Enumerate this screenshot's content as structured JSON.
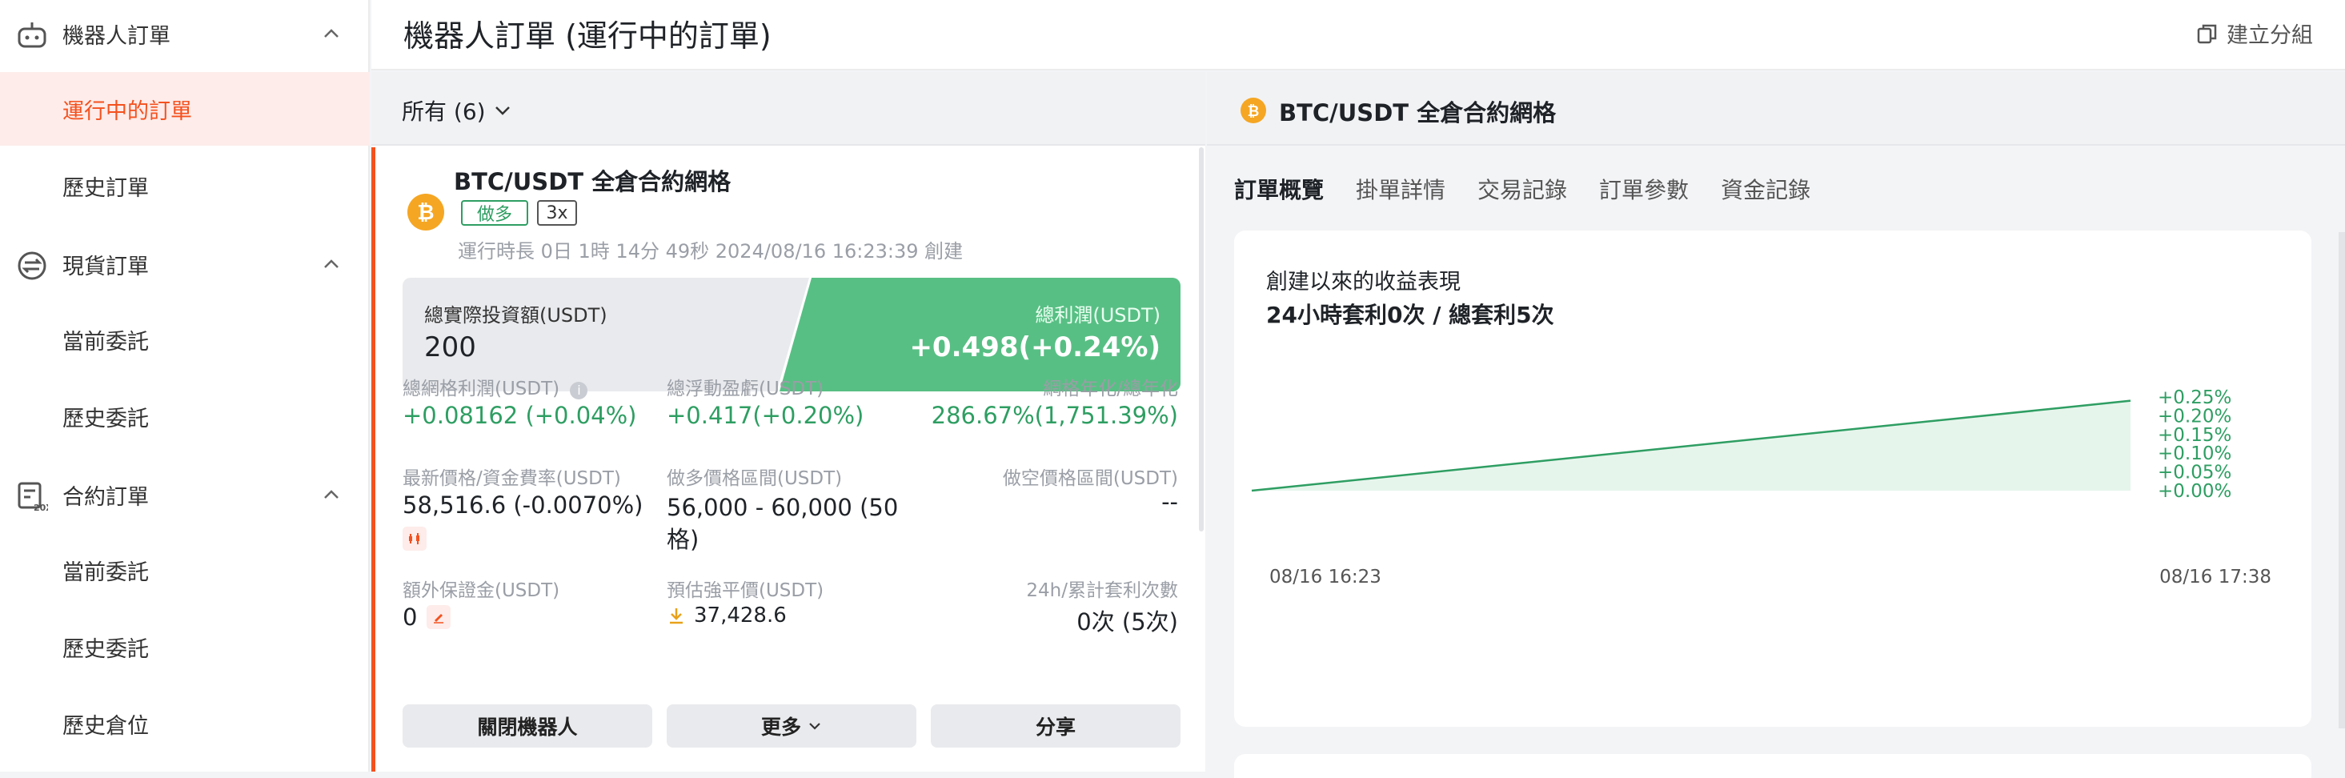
{
  "sidebar": {
    "groups": [
      {
        "label": "機器人訂單",
        "icon": "robot-icon",
        "items": [
          "運行中的訂單",
          "歷史訂單"
        ]
      },
      {
        "label": "現貨訂單",
        "icon": "exchange-icon",
        "items": [
          "當前委託",
          "歷史委託"
        ]
      },
      {
        "label": "合約訂單",
        "icon": "contract-icon",
        "items": [
          "當前委託",
          "歷史委託",
          "歷史倉位"
        ]
      }
    ]
  },
  "header": {
    "title": "機器人訂單 (運行中的訂單)",
    "create_group": "建立分組"
  },
  "filter": {
    "label": "所有 (6)"
  },
  "order": {
    "pair": "BTC/USDT 全倉合約網格",
    "direction": "做多",
    "leverage": "3x",
    "runtime": "運行時長 0日 1時 14分 49秒 2024/08/16 16:23:39 創建",
    "invest_label": "總實際投資額(USDT)",
    "invest_value": "200",
    "profit_label": "總利潤(USDT)",
    "profit_value": "+0.498(+0.24%)",
    "grid_profit_label": "總網格利潤(USDT)",
    "grid_profit_value": "+0.08162 (+0.04%)",
    "float_pnl_label": "總浮動盈虧(USDT)",
    "float_pnl_value": "+0.417(+0.20%)",
    "apr_label": "網格年化/總年化",
    "apr_value": "286.67%(1,751.39%)",
    "last_price_label": "最新價格/資金費率(USDT)",
    "last_price_value": "58,516.6 (-0.0070%)",
    "long_range_label": "做多價格區間(USDT)",
    "long_range_value": "56,000 - 60,000 (50格)",
    "short_range_label": "做空價格區間(USDT)",
    "short_range_value": "--",
    "extra_margin_label": "額外保證金(USDT)",
    "extra_margin_value": "0",
    "liq_label": "預估強平價(USDT)",
    "liq_value": "37,428.6",
    "arb_label": "24h/累計套利次數",
    "arb_value": "0次 (5次)",
    "buttons": {
      "close": "關閉機器人",
      "more": "更多",
      "share": "分享"
    }
  },
  "detail": {
    "title": "BTC/USDT 全倉合約網格",
    "tabs": [
      "訂單概覽",
      "掛單詳情",
      "交易記錄",
      "訂單參數",
      "資金記錄"
    ],
    "active_tab": 0,
    "chart_title": "創建以來的收益表現",
    "chart_sub": "24小時套利0次 / 總套利5次"
  },
  "chart_data": {
    "type": "area",
    "x": [
      "08/16 16:23",
      "08/16 17:38"
    ],
    "values": [
      0.0,
      0.24
    ],
    "y_ticks": [
      "+0.25%",
      "+0.20%",
      "+0.15%",
      "+0.10%",
      "+0.05%",
      "+0.00%"
    ],
    "ylim": [
      0,
      0.25
    ],
    "color": "#2e9e62",
    "fill": "#e6f5ec",
    "y_axis_side": "right",
    "grid": false
  }
}
